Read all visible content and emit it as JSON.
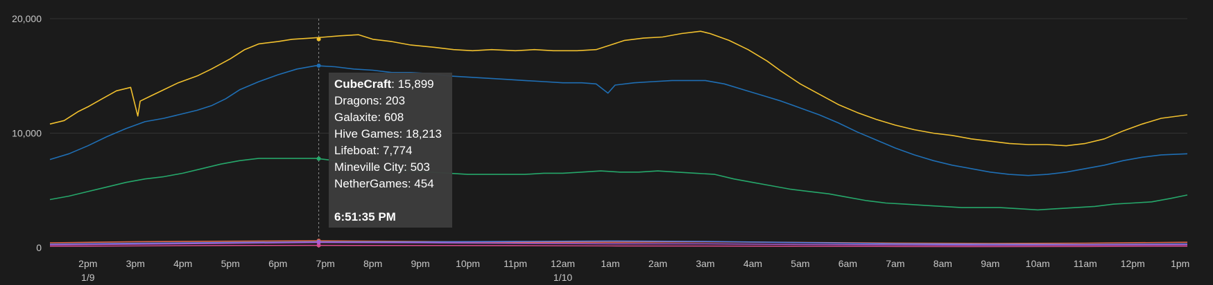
{
  "chart_data": {
    "type": "line",
    "ylim": [
      0,
      20000
    ],
    "yticks": [
      "0",
      "10,000",
      "20,000"
    ],
    "xticks": [
      "2pm",
      "3pm",
      "4pm",
      "5pm",
      "6pm",
      "7pm",
      "8pm",
      "9pm",
      "10pm",
      "11pm",
      "12am",
      "1am",
      "2am",
      "3am",
      "4am",
      "5am",
      "6am",
      "7am",
      "8am",
      "9am",
      "10am",
      "11am",
      "12pm",
      "1pm"
    ],
    "xdates": [
      {
        "at": "2pm",
        "label": "1/9"
      },
      {
        "at": "12am",
        "label": "1/10"
      }
    ],
    "x_range_hours": [
      13.2,
      37.15
    ],
    "grid": true,
    "series": [
      {
        "name": "Hive Games",
        "color": "#f2c12e",
        "points": [
          [
            13.2,
            10800
          ],
          [
            13.5,
            11100
          ],
          [
            13.8,
            11900
          ],
          [
            14.0,
            12300
          ],
          [
            14.3,
            13000
          ],
          [
            14.6,
            13700
          ],
          [
            14.9,
            14000
          ],
          [
            15.05,
            11500
          ],
          [
            15.1,
            12800
          ],
          [
            15.3,
            13200
          ],
          [
            15.6,
            13800
          ],
          [
            15.9,
            14400
          ],
          [
            16.3,
            15000
          ],
          [
            16.6,
            15600
          ],
          [
            17.0,
            16500
          ],
          [
            17.3,
            17300
          ],
          [
            17.6,
            17800
          ],
          [
            18.0,
            18000
          ],
          [
            18.3,
            18200
          ],
          [
            18.7,
            18300
          ],
          [
            19.0,
            18400
          ],
          [
            19.3,
            18500
          ],
          [
            19.7,
            18600
          ],
          [
            20.0,
            18200
          ],
          [
            20.4,
            18000
          ],
          [
            20.8,
            17700
          ],
          [
            21.3,
            17500
          ],
          [
            21.7,
            17300
          ],
          [
            22.1,
            17200
          ],
          [
            22.5,
            17300
          ],
          [
            23.0,
            17200
          ],
          [
            23.4,
            17300
          ],
          [
            23.8,
            17200
          ],
          [
            24.3,
            17200
          ],
          [
            24.7,
            17300
          ],
          [
            25.0,
            17700
          ],
          [
            25.3,
            18100
          ],
          [
            25.7,
            18300
          ],
          [
            26.1,
            18400
          ],
          [
            26.5,
            18700
          ],
          [
            26.9,
            18900
          ],
          [
            27.1,
            18700
          ],
          [
            27.5,
            18100
          ],
          [
            27.9,
            17300
          ],
          [
            28.3,
            16300
          ],
          [
            28.6,
            15400
          ],
          [
            29.0,
            14300
          ],
          [
            29.4,
            13400
          ],
          [
            29.8,
            12500
          ],
          [
            30.2,
            11800
          ],
          [
            30.6,
            11200
          ],
          [
            31.0,
            10700
          ],
          [
            31.4,
            10300
          ],
          [
            31.8,
            10000
          ],
          [
            32.2,
            9800
          ],
          [
            32.6,
            9500
          ],
          [
            33.0,
            9300
          ],
          [
            33.4,
            9100
          ],
          [
            33.8,
            9000
          ],
          [
            34.2,
            9000
          ],
          [
            34.6,
            8900
          ],
          [
            35.0,
            9100
          ],
          [
            35.4,
            9500
          ],
          [
            35.8,
            10200
          ],
          [
            36.2,
            10800
          ],
          [
            36.6,
            11300
          ],
          [
            37.15,
            11600
          ]
        ]
      },
      {
        "name": "CubeCraft",
        "color": "#1f6fb5",
        "points": [
          [
            13.2,
            7700
          ],
          [
            13.6,
            8200
          ],
          [
            14.0,
            8900
          ],
          [
            14.4,
            9700
          ],
          [
            14.8,
            10400
          ],
          [
            15.2,
            11000
          ],
          [
            15.6,
            11300
          ],
          [
            16.0,
            11700
          ],
          [
            16.3,
            12000
          ],
          [
            16.6,
            12400
          ],
          [
            16.9,
            13000
          ],
          [
            17.2,
            13800
          ],
          [
            17.6,
            14500
          ],
          [
            18.0,
            15100
          ],
          [
            18.4,
            15600
          ],
          [
            18.8,
            15900
          ],
          [
            19.2,
            15800
          ],
          [
            19.6,
            15600
          ],
          [
            20.0,
            15500
          ],
          [
            20.4,
            15300
          ],
          [
            20.8,
            15300
          ],
          [
            21.2,
            15200
          ],
          [
            21.6,
            15000
          ],
          [
            22.0,
            14900
          ],
          [
            22.4,
            14800
          ],
          [
            22.8,
            14700
          ],
          [
            23.2,
            14600
          ],
          [
            23.6,
            14500
          ],
          [
            24.0,
            14400
          ],
          [
            24.4,
            14400
          ],
          [
            24.7,
            14300
          ],
          [
            24.95,
            13500
          ],
          [
            25.1,
            14200
          ],
          [
            25.5,
            14400
          ],
          [
            25.9,
            14500
          ],
          [
            26.3,
            14600
          ],
          [
            26.7,
            14600
          ],
          [
            27.0,
            14600
          ],
          [
            27.4,
            14300
          ],
          [
            27.8,
            13800
          ],
          [
            28.2,
            13300
          ],
          [
            28.6,
            12800
          ],
          [
            29.0,
            12200
          ],
          [
            29.4,
            11600
          ],
          [
            29.8,
            10900
          ],
          [
            30.2,
            10100
          ],
          [
            30.6,
            9400
          ],
          [
            31.0,
            8700
          ],
          [
            31.4,
            8100
          ],
          [
            31.8,
            7600
          ],
          [
            32.2,
            7200
          ],
          [
            32.6,
            6900
          ],
          [
            33.0,
            6600
          ],
          [
            33.4,
            6400
          ],
          [
            33.8,
            6300
          ],
          [
            34.2,
            6400
          ],
          [
            34.6,
            6600
          ],
          [
            35.0,
            6900
          ],
          [
            35.4,
            7200
          ],
          [
            35.8,
            7600
          ],
          [
            36.2,
            7900
          ],
          [
            36.6,
            8100
          ],
          [
            37.15,
            8200
          ]
        ]
      },
      {
        "name": "Lifeboat",
        "color": "#26a86b",
        "points": [
          [
            13.2,
            4200
          ],
          [
            13.6,
            4500
          ],
          [
            14.0,
            4900
          ],
          [
            14.4,
            5300
          ],
          [
            14.8,
            5700
          ],
          [
            15.2,
            6000
          ],
          [
            15.6,
            6200
          ],
          [
            16.0,
            6500
          ],
          [
            16.4,
            6900
          ],
          [
            16.8,
            7300
          ],
          [
            17.2,
            7600
          ],
          [
            17.6,
            7800
          ],
          [
            18.0,
            7800
          ],
          [
            18.4,
            7800
          ],
          [
            18.8,
            7800
          ],
          [
            19.2,
            7600
          ],
          [
            19.6,
            7300
          ],
          [
            20.0,
            7000
          ],
          [
            20.4,
            6800
          ],
          [
            20.8,
            6700
          ],
          [
            21.2,
            6600
          ],
          [
            21.6,
            6500
          ],
          [
            22.0,
            6400
          ],
          [
            22.4,
            6400
          ],
          [
            22.8,
            6400
          ],
          [
            23.2,
            6400
          ],
          [
            23.6,
            6500
          ],
          [
            24.0,
            6500
          ],
          [
            24.4,
            6600
          ],
          [
            24.8,
            6700
          ],
          [
            25.2,
            6600
          ],
          [
            25.6,
            6600
          ],
          [
            26.0,
            6700
          ],
          [
            26.4,
            6600
          ],
          [
            26.8,
            6500
          ],
          [
            27.2,
            6400
          ],
          [
            27.6,
            6000
          ],
          [
            28.0,
            5700
          ],
          [
            28.4,
            5400
          ],
          [
            28.8,
            5100
          ],
          [
            29.2,
            4900
          ],
          [
            29.6,
            4700
          ],
          [
            30.0,
            4400
          ],
          [
            30.4,
            4100
          ],
          [
            30.8,
            3900
          ],
          [
            31.2,
            3800
          ],
          [
            31.6,
            3700
          ],
          [
            32.0,
            3600
          ],
          [
            32.4,
            3500
          ],
          [
            32.8,
            3500
          ],
          [
            33.2,
            3500
          ],
          [
            33.6,
            3400
          ],
          [
            34.0,
            3300
          ],
          [
            34.4,
            3400
          ],
          [
            34.8,
            3500
          ],
          [
            35.2,
            3600
          ],
          [
            35.6,
            3800
          ],
          [
            36.0,
            3900
          ],
          [
            36.4,
            4000
          ],
          [
            36.8,
            4300
          ],
          [
            37.15,
            4600
          ]
        ]
      },
      {
        "name": "Galaxite",
        "color": "#e0664a",
        "points": [
          [
            13.2,
            420
          ],
          [
            15.0,
            520
          ],
          [
            17.0,
            560
          ],
          [
            18.8,
            600
          ],
          [
            21.0,
            540
          ],
          [
            23.0,
            470
          ],
          [
            25.0,
            470
          ],
          [
            27.0,
            500
          ],
          [
            29.0,
            460
          ],
          [
            31.0,
            400
          ],
          [
            33.0,
            370
          ],
          [
            35.0,
            390
          ],
          [
            37.15,
            470
          ]
        ]
      },
      {
        "name": "Mineville City",
        "color": "#5a7de0",
        "points": [
          [
            13.2,
            300
          ],
          [
            15.0,
            380
          ],
          [
            17.0,
            450
          ],
          [
            18.8,
            500
          ],
          [
            21.0,
            500
          ],
          [
            23.0,
            540
          ],
          [
            25.0,
            580
          ],
          [
            27.0,
            540
          ],
          [
            29.0,
            440
          ],
          [
            31.0,
            340
          ],
          [
            33.0,
            300
          ],
          [
            35.0,
            280
          ],
          [
            37.15,
            330
          ]
        ]
      },
      {
        "name": "NetherGames",
        "color": "#b05ad0",
        "points": [
          [
            13.2,
            250
          ],
          [
            15.0,
            300
          ],
          [
            17.0,
            380
          ],
          [
            18.8,
            450
          ],
          [
            21.0,
            420
          ],
          [
            23.0,
            380
          ],
          [
            25.0,
            340
          ],
          [
            27.0,
            330
          ],
          [
            29.0,
            280
          ],
          [
            31.0,
            240
          ],
          [
            33.0,
            220
          ],
          [
            35.0,
            230
          ],
          [
            37.15,
            260
          ]
        ]
      },
      {
        "name": "Dragons",
        "color": "#d44a8a",
        "points": [
          [
            13.2,
            120
          ],
          [
            15.0,
            150
          ],
          [
            17.0,
            190
          ],
          [
            18.8,
            200
          ],
          [
            21.0,
            190
          ],
          [
            23.0,
            170
          ],
          [
            25.0,
            150
          ],
          [
            27.0,
            140
          ],
          [
            29.0,
            120
          ],
          [
            31.0,
            100
          ],
          [
            33.0,
            90
          ],
          [
            35.0,
            100
          ],
          [
            37.15,
            130
          ]
        ]
      }
    ],
    "hover_x_hours": 18.86,
    "tooltip": {
      "rows": [
        {
          "name": "CubeCraft",
          "value": "15,899",
          "bold": true
        },
        {
          "name": "Dragons",
          "value": "203"
        },
        {
          "name": "Galaxite",
          "value": "608"
        },
        {
          "name": "Hive Games",
          "value": "18,213"
        },
        {
          "name": "Lifeboat",
          "value": "7,774"
        },
        {
          "name": "Mineville City",
          "value": "503"
        },
        {
          "name": "NetherGames",
          "value": "454"
        }
      ],
      "time": "6:51:35 PM"
    }
  }
}
